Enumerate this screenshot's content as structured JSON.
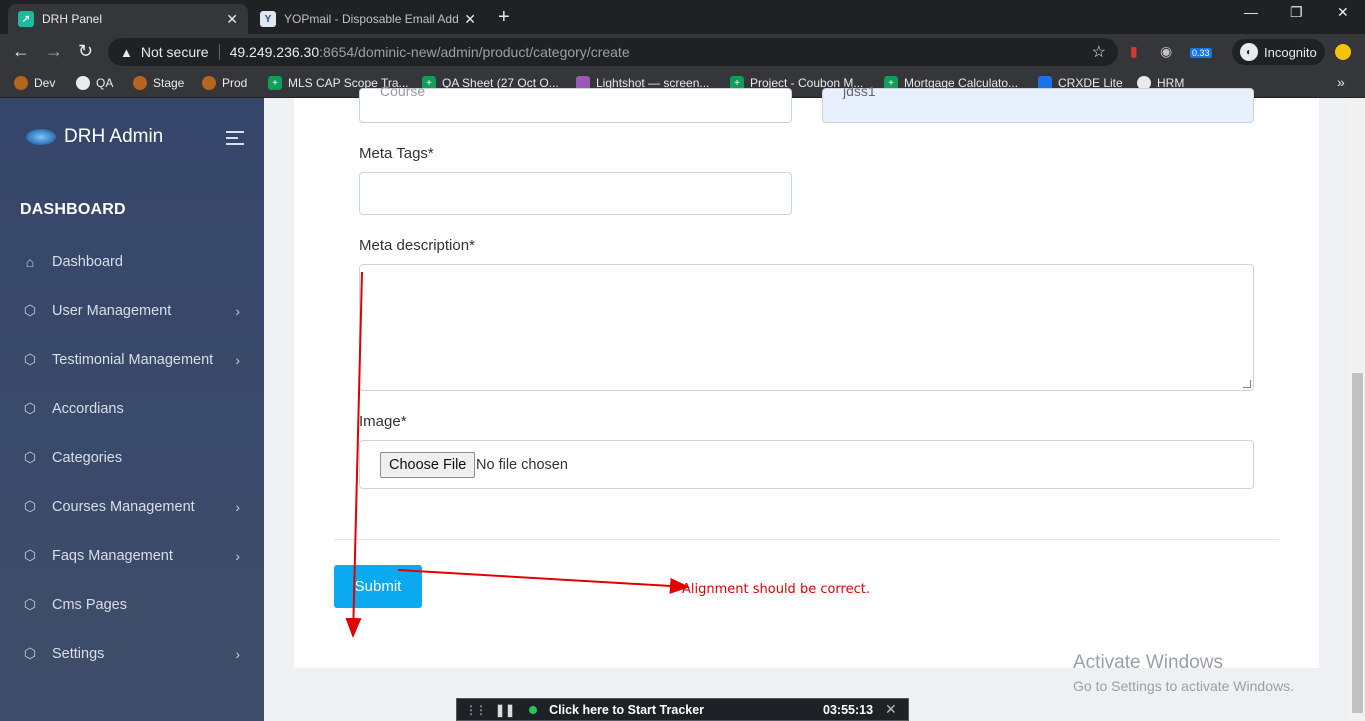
{
  "browser": {
    "tabs": [
      {
        "label": "DRH Panel",
        "close": "✕"
      },
      {
        "label": "YOPmail - Disposable Email Addr",
        "close": "✕"
      }
    ],
    "new_tab": "+",
    "window_controls": {
      "minimize": "—",
      "restore": "❐",
      "close": "✕"
    },
    "security_label": "Not secure",
    "url_host": "49.249.236.30",
    "url_path": ":8654/dominic-new/admin/product/category/create",
    "incognito_label": "Incognito",
    "extension_badge": "0.33",
    "bookmarks": [
      "Dev",
      "QA",
      "Stage",
      "Prod",
      "MLS CAP Scope Tra...",
      "QA Sheet (27 Oct O...",
      "Lightshot — screen...",
      "Project - Coubon M...",
      "Mortgage Calculato...",
      "CRXDE Lite",
      "HRM"
    ],
    "bookmarks_more": "»"
  },
  "sidebar": {
    "brand": "DRH Admin",
    "section_title": "DASHBOARD",
    "items": [
      {
        "label": "Dashboard",
        "icon": "home-icon",
        "has_children": false
      },
      {
        "label": "User Management",
        "icon": "cube-icon",
        "has_children": true
      },
      {
        "label": "Testimonial Management",
        "icon": "cube-icon",
        "has_children": true
      },
      {
        "label": "Accordians",
        "icon": "cube-icon",
        "has_children": false
      },
      {
        "label": "Categories",
        "icon": "cube-icon",
        "has_children": false
      },
      {
        "label": "Courses Management",
        "icon": "cube-icon",
        "has_children": true
      },
      {
        "label": "Faqs Management",
        "icon": "cube-icon",
        "has_children": true
      },
      {
        "label": "Cms Pages",
        "icon": "cube-icon",
        "has_children": false
      },
      {
        "label": "Settings",
        "icon": "cube-icon",
        "has_children": true
      }
    ]
  },
  "form": {
    "type_value": "Course",
    "slug_value": "jdss1",
    "meta_tags_label": "Meta Tags*",
    "meta_tags_value": "",
    "meta_description_label": "Meta description*",
    "meta_description_value": "",
    "image_label": "Image*",
    "choose_file_label": "Choose File",
    "no_file_text": "No file chosen",
    "submit_label": "Submit"
  },
  "annotation": {
    "text": "Alignment should be correct.",
    "color": "#e00000"
  },
  "windows_watermark": {
    "line1": "Activate Windows",
    "line2": "Go to Settings to activate Windows."
  },
  "tracker": {
    "label": "Click here to Start Tracker",
    "time": "03:55:13"
  }
}
